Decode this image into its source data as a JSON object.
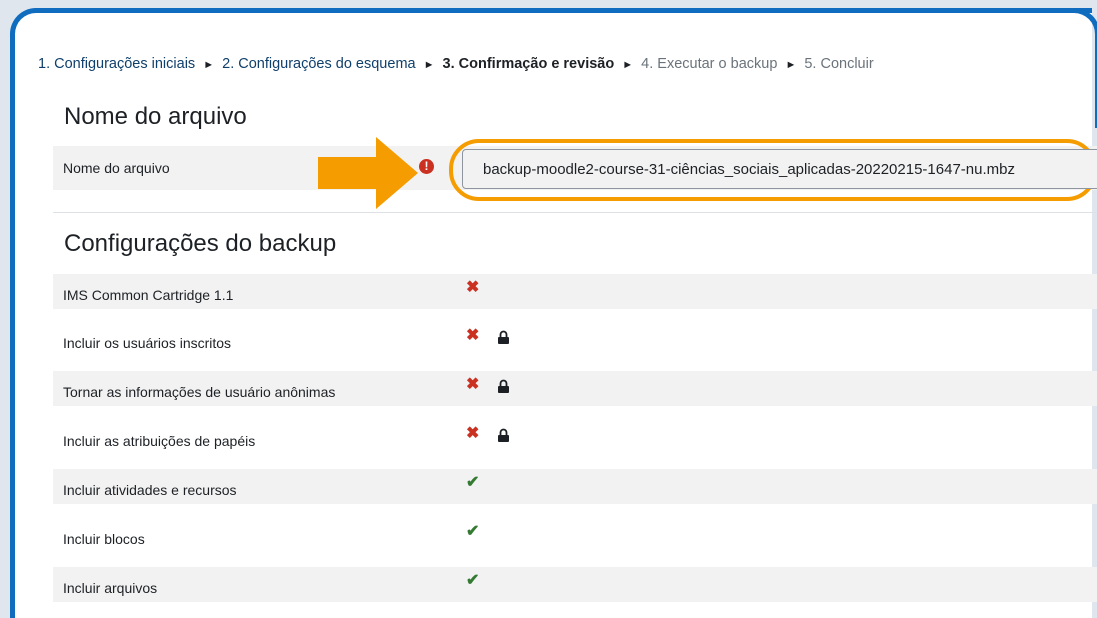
{
  "breadcrumb": {
    "step1": "1. Configurações iniciais",
    "step2": "2. Configurações do esquema",
    "step3": "3. Confirmação e revisão",
    "step4": "4. Executar o backup",
    "step5": "5. Concluir",
    "separator": "►"
  },
  "filename_section": {
    "title": "Nome do arquivo",
    "label": "Nome do arquivo",
    "value": "backup-moodle2-course-31-ciências_sociais_aplicadas-20220215-1647-nu.mbz",
    "error_icon": "exclamation-circle-icon"
  },
  "settings_section": {
    "title": "Configurações do backup",
    "rows": [
      {
        "label": "IMS Common Cartridge 1.1",
        "status": "✖",
        "locked": false
      },
      {
        "label": "Incluir os usuários inscritos",
        "status": "✖",
        "locked": true
      },
      {
        "label": "Tornar as informações de usuário anônimas",
        "status": "✖",
        "locked": true
      },
      {
        "label": "Incluir as atribuições de papéis",
        "status": "✖",
        "locked": true
      },
      {
        "label": "Incluir atividades e recursos",
        "status": "✔",
        "locked": false
      },
      {
        "label": "Incluir blocos",
        "status": "✔",
        "locked": false
      },
      {
        "label": "Incluir arquivos",
        "status": "✔",
        "locked": false
      }
    ]
  },
  "colors": {
    "frame": "#0f6cbf",
    "highlight": "#f59c00",
    "error": "#ca3120",
    "success": "#357a32"
  }
}
